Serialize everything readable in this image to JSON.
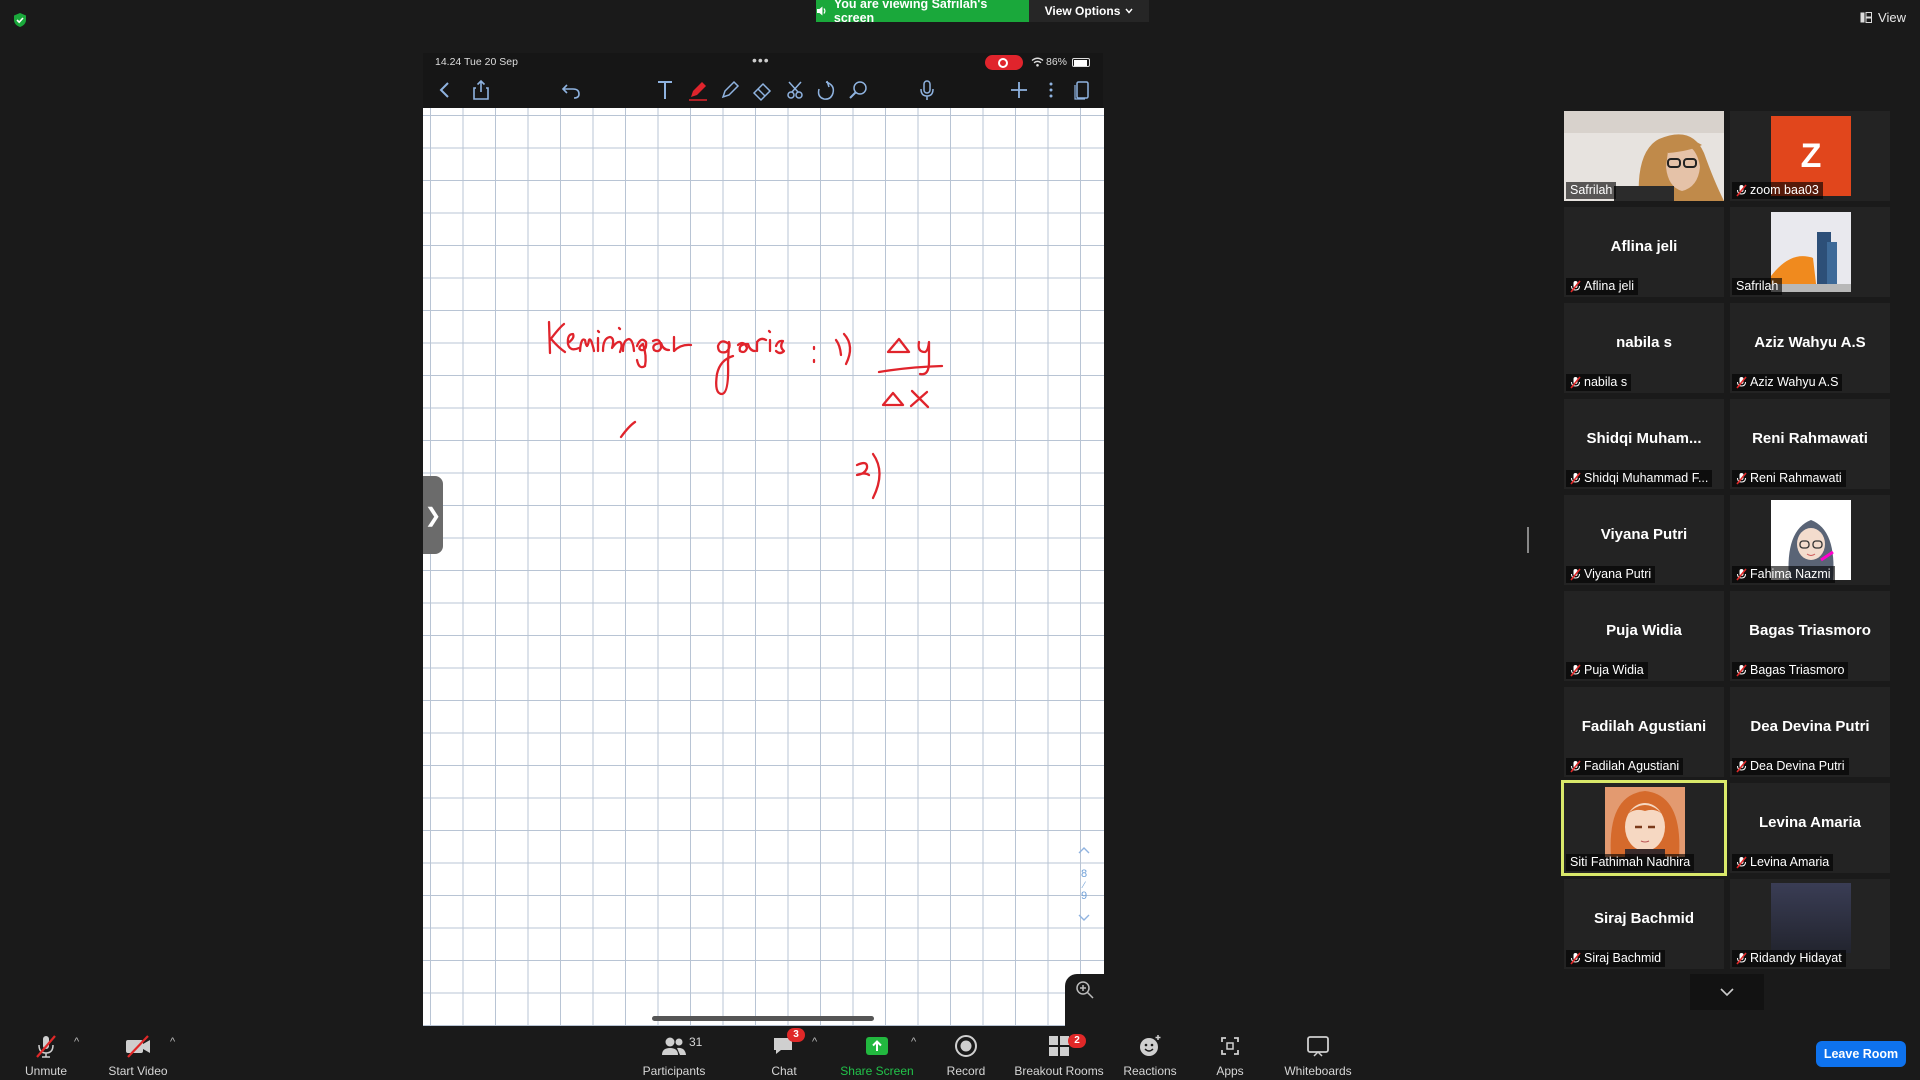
{
  "banner": {
    "text": "You are viewing Safrilah's screen",
    "view_options": "View Options",
    "view": "View"
  },
  "ipad": {
    "time": "14.24  Tue 20 Sep",
    "battery": "86%",
    "page_current": "8",
    "page_total": "9"
  },
  "gallery": [
    {
      "big": "",
      "label": "Safrilah",
      "muted": false,
      "kind": "photo-hijab"
    },
    {
      "big": "",
      "label": "zoom baa03",
      "muted": true,
      "kind": "avatar-z",
      "letter": "Z"
    },
    {
      "big": "Aflina jeli",
      "label": "Aflina jeli",
      "muted": true,
      "kind": "name"
    },
    {
      "big": "",
      "label": "Safrilah",
      "muted": false,
      "kind": "photo-building"
    },
    {
      "big": "nabila s",
      "label": "nabila s",
      "muted": true,
      "kind": "name"
    },
    {
      "big": "Aziz Wahyu A.S",
      "label": "Aziz Wahyu A.S",
      "muted": true,
      "kind": "name"
    },
    {
      "big": "Shidqi  Muham...",
      "label": "Shidqi Muhammad F...",
      "muted": true,
      "kind": "name"
    },
    {
      "big": "Reni Rahmawati",
      "label": "Reni Rahmawati",
      "muted": true,
      "kind": "name"
    },
    {
      "big": "Viyana Putri",
      "label": "Viyana Putri",
      "muted": true,
      "kind": "name"
    },
    {
      "big": "",
      "label": "Fahima Nazmi",
      "muted": true,
      "kind": "photo-cartoon"
    },
    {
      "big": "Puja Widia",
      "label": "Puja Widia",
      "muted": true,
      "kind": "name"
    },
    {
      "big": "Bagas Triasmoro",
      "label": "Bagas Triasmoro",
      "muted": true,
      "kind": "name"
    },
    {
      "big": "Fadilah Agustiani",
      "label": "Fadilah Agustiani",
      "muted": true,
      "kind": "name"
    },
    {
      "big": "Dea Devina Putri",
      "label": "Dea Devina Putri",
      "muted": true,
      "kind": "name"
    },
    {
      "big": "",
      "label": "Siti Fathimah Nadhira",
      "muted": false,
      "kind": "photo-anime",
      "highlight": true
    },
    {
      "big": "Levina Amaria",
      "label": "Levina Amaria",
      "muted": true,
      "kind": "name"
    },
    {
      "big": "Siraj Bachmid",
      "label": "Siraj Bachmid",
      "muted": true,
      "kind": "name"
    },
    {
      "big": "",
      "label": "Ridandy Hidayat",
      "muted": true,
      "kind": "photo-dark"
    }
  ],
  "toolbar": {
    "unmute": "Unmute",
    "start_video": "Start Video",
    "participants": "Participants",
    "participants_count": "31",
    "chat": "Chat",
    "chat_badge": "3",
    "share_screen": "Share Screen",
    "record": "Record",
    "breakout": "Breakout Rooms",
    "breakout_badge": "2",
    "reactions": "Reactions",
    "apps": "Apps",
    "whiteboards": "Whiteboards",
    "leave": "Leave Room"
  },
  "colors": {
    "share_green": "#1aa83b",
    "leave_blue": "#0e72ed",
    "ink_red": "#e0242c",
    "highlight": "#d9e86a"
  }
}
